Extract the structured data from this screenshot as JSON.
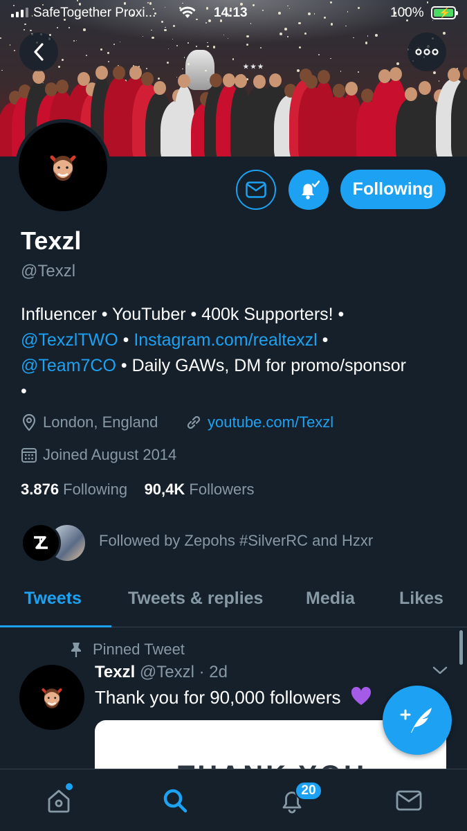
{
  "status_bar": {
    "carrier": "SafeTogether Proxi...",
    "time": "14:13",
    "battery_percent": "100%"
  },
  "nav": {
    "back_icon": "chevron-left-icon",
    "more_icon": "more-dots-icon"
  },
  "profile": {
    "display_name": "Texzl",
    "handle": "@Texzl",
    "bio": {
      "line1": "Influencer • YouTuber • 400k Supporters! •",
      "mention1": "@TexzlTWO",
      "sep1": " • ",
      "link1": "Instagram.com/realtexzl",
      "sep2": " •",
      "mention2": "@Team7CO",
      "line3_rest": " • Daily GAWs, DM for promo/sponsor",
      "line4": "•"
    },
    "location": "London, England",
    "website": "youtube.com/Texzl",
    "joined": "Joined August 2014",
    "following_count": "3.876",
    "following_label": " Following",
    "followers_count": "90,4K",
    "followers_label": " Followers",
    "followed_by": "Followed by Zepohs #SilverRC and Hzxr",
    "following_button": "Following"
  },
  "tabs": [
    {
      "label": "Tweets",
      "active": true
    },
    {
      "label": "Tweets & replies",
      "active": false
    },
    {
      "label": "Media",
      "active": false
    },
    {
      "label": "Likes",
      "active": false
    }
  ],
  "pinned_tweet": {
    "pinned_label": "Pinned Tweet",
    "author_name": "Texzl",
    "author_handle": "@Texzl",
    "time": "· 2d",
    "text": "Thank you for 90,000 followers",
    "media_text": "THANK YOU"
  },
  "bottom_nav": {
    "notifications_badge": "20",
    "items": [
      "home-icon",
      "search-icon",
      "notifications-icon",
      "messages-icon"
    ]
  },
  "colors": {
    "background": "#15202b",
    "accent": "#1da1f2",
    "secondary_text": "#8899a6",
    "divider": "#38444d"
  }
}
